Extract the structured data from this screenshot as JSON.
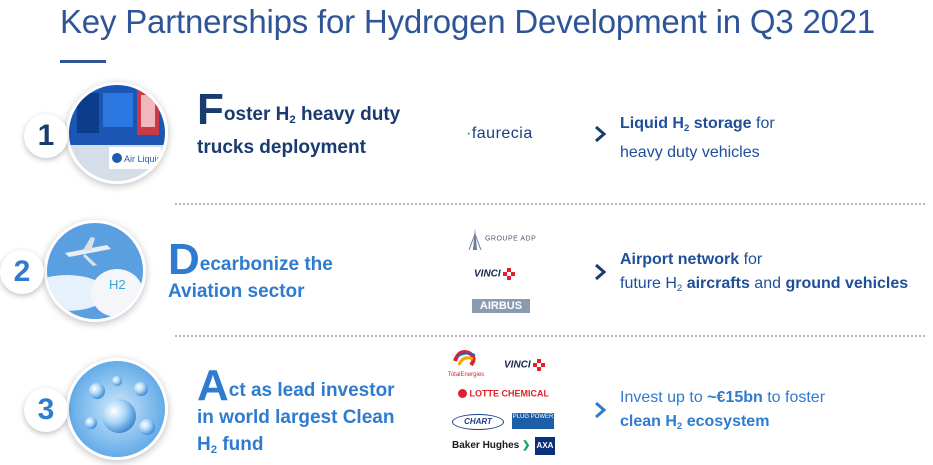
{
  "title": "Key Partnerships for Hydrogen Development in Q3 2021",
  "colors": {
    "title": "#2f5597",
    "row1": "#1a3b6f",
    "row2": "#2e7bcf",
    "row3": "#2e7bcf",
    "desc": "#1f4e9a"
  },
  "rows": [
    {
      "number": "1",
      "heading": {
        "cap": "F",
        "line1": "oster H",
        "sub": "2",
        "line1b": " heavy duty",
        "line2": "trucks deployment"
      },
      "photo_label": "Air Liquide",
      "partners": [
        "faurecia"
      ],
      "desc": {
        "b1": "Liquid H",
        "sub": "2",
        "b1b": " storage",
        "t1": " for",
        "t2": "heavy duty vehicles"
      }
    },
    {
      "number": "2",
      "heading": {
        "line1_cap": "D",
        "line1": "ecarbonize the",
        "line2": "Aviation sector"
      },
      "photo_label": "H2",
      "partners": [
        "GROUPE ADP",
        "VINCI",
        "AIRBUS"
      ],
      "desc": {
        "b1": "Airport network",
        "t1": " for",
        "t2": "future H",
        "sub": "2",
        "b2": " aircrafts",
        "t3": " and ",
        "b3": "ground vehicles"
      }
    },
    {
      "number": "3",
      "heading": {
        "cap": "A",
        "line1": "ct as lead investor",
        "line2": "in world largest Clean",
        "line3a": "H",
        "sub": "2",
        "line3b": " fund"
      },
      "partners": [
        "TotalEnergies",
        "VINCI",
        "LOTTE CHEMICAL",
        "CHART",
        "PLUG POWER",
        "Baker Hughes",
        "AXA"
      ],
      "desc": {
        "t1": "Invest up to ",
        "b1": "~€15bn",
        "t2": " to foster",
        "b2a": "clean H",
        "sub": "2",
        "b2b": " ecosystem"
      }
    }
  ]
}
